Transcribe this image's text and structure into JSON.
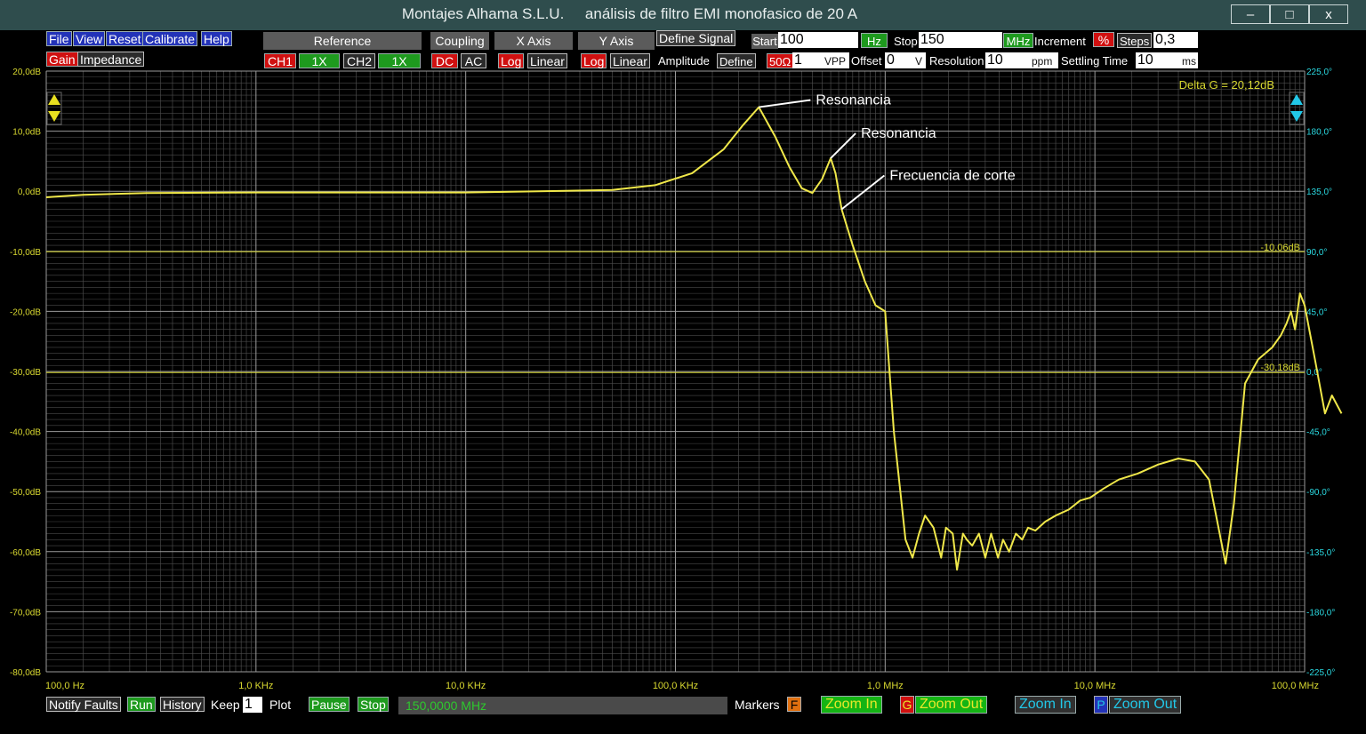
{
  "window": {
    "title": "Montajes Alhama S.L.U.     análisis de filtro EMI monofasico de 20 A",
    "minimize": "–",
    "maximize": "□",
    "close": "x"
  },
  "menu": {
    "file": "File",
    "view": "View",
    "reset": "Reset",
    "calibrate": "Calibrate",
    "help": "Help",
    "gain": "Gain",
    "impedance": "Impedance"
  },
  "toolbar": {
    "reference": "Reference",
    "coupling": "Coupling",
    "x_axis": "X Axis",
    "y_axis": "Y Axis",
    "define_signal": "Define Signal",
    "ch1": "CH1",
    "ch1_x": "1X",
    "ch2": "CH2",
    "ch2_x": "1X",
    "dc": "DC",
    "ac": "AC",
    "x_log": "Log",
    "x_linear": "Linear",
    "y_log": "Log",
    "y_linear": "Linear",
    "amplitude": "Amplitude",
    "define": "Define",
    "ohm": "50Ω",
    "amplitude_value": "1",
    "vpp": "VPP",
    "offset": "Offset",
    "offset_value": "0",
    "offset_unit": "V",
    "start": "Start",
    "start_value": "100",
    "start_unit": "Hz",
    "stop": "Stop",
    "stop_value": "150",
    "stop_unit": "MHz",
    "increment": "Increment",
    "increment_pct": "%",
    "steps": "Steps",
    "steps_value": "0,3",
    "resolution": "Resolution",
    "resolution_value": "10",
    "resolution_unit": "ppm",
    "settling": "Settling Time",
    "settling_value": "10",
    "settling_unit": "ms"
  },
  "plot": {
    "delta_g": "Delta G = 20,12dB",
    "marker_a": "-10,06dB",
    "marker_b": "-30,18dB",
    "annotations": [
      "Resonancia",
      "Resonancia",
      "Frecuencia de corte"
    ]
  },
  "status": {
    "notify_faults": "Notify Faults",
    "run": "Run",
    "history": "History",
    "keep": "Keep",
    "keep_value": "1",
    "plot": "Plot",
    "pause": "Pause",
    "stop": "Stop",
    "frequency": "150,0000 MHz",
    "markers": "Markers",
    "markers_f": "F",
    "zoom_in_g": "Zoom In",
    "g": "G",
    "zoom_out_g": "Zoom Out",
    "zoom_in_p": "Zoom In",
    "p": "P",
    "zoom_out_p": "Zoom Out"
  },
  "colors": {
    "trace": "#f0e84a",
    "gain_axis": "#d8d830",
    "phase_axis": "#2ad8e0",
    "grid": "#5a5a5a"
  },
  "chart_data": {
    "type": "line",
    "xscale": "log",
    "xlim": [
      100,
      100000000
    ],
    "ylim": [
      -80,
      20
    ],
    "y2lim": [
      -225,
      225
    ],
    "grid": true,
    "x_tick_labels": [
      "100,0 Hz",
      "1,0 KHz",
      "10,0 KHz",
      "100,0 KHz",
      "1,0 MHz",
      "10,0 MHz",
      "100,0 MHz"
    ],
    "y_tick_labels": [
      "20,0dB",
      "10,0dB",
      "0,0dB",
      "-10,0dB",
      "-20,0dB",
      "-30,0dB",
      "-40,0dB",
      "-50,0dB",
      "-60,0dB",
      "-70,0dB",
      "-80,0dB"
    ],
    "y2_tick_labels": [
      "225,0°",
      "180,0°",
      "135,0°",
      "90,0°",
      "45,0°",
      "0,0°",
      "-45,0°",
      "-90,0°",
      "-135,0°",
      "-180,0°",
      "-225,0°"
    ],
    "hlines": [
      -10.06,
      -30.18
    ],
    "annotation_points": [
      [
        250000,
        14
      ],
      [
        550000,
        5.5
      ],
      [
        620000,
        -3
      ]
    ],
    "series": [
      {
        "points": [
          [
            100,
            -1
          ],
          [
            150,
            -0.6
          ],
          [
            300,
            -0.3
          ],
          [
            1000,
            -0.2
          ],
          [
            10000,
            -0.2
          ],
          [
            50000,
            0.2
          ],
          [
            80000,
            1
          ],
          [
            120000,
            3
          ],
          [
            170000,
            7
          ],
          [
            210000,
            11
          ],
          [
            250000,
            14
          ],
          [
            300000,
            9
          ],
          [
            350000,
            4
          ],
          [
            400000,
            0.5
          ],
          [
            450000,
            -0.3
          ],
          [
            500000,
            2
          ],
          [
            550000,
            5.5
          ],
          [
            580000,
            3
          ],
          [
            620000,
            -3
          ],
          [
            700000,
            -9
          ],
          [
            800000,
            -15
          ],
          [
            900000,
            -19
          ],
          [
            1000000,
            -20
          ],
          [
            1100000,
            -40
          ],
          [
            1250000,
            -58
          ],
          [
            1350000,
            -61
          ],
          [
            1450000,
            -57
          ],
          [
            1550000,
            -54
          ],
          [
            1700000,
            -56
          ],
          [
            1850000,
            -61
          ],
          [
            1950000,
            -56
          ],
          [
            2100000,
            -57
          ],
          [
            2200000,
            -63
          ],
          [
            2350000,
            -57
          ],
          [
            2450000,
            -58
          ],
          [
            2600000,
            -59
          ],
          [
            2800000,
            -57
          ],
          [
            3000000,
            -61
          ],
          [
            3200000,
            -57
          ],
          [
            3450000,
            -61
          ],
          [
            3650000,
            -58
          ],
          [
            3900000,
            -60
          ],
          [
            4200000,
            -57
          ],
          [
            4500000,
            -58
          ],
          [
            4800000,
            -56
          ],
          [
            5200000,
            -56.5
          ],
          [
            5800000,
            -55
          ],
          [
            6500000,
            -54
          ],
          [
            7500000,
            -53
          ],
          [
            8500000,
            -51.5
          ],
          [
            9500000,
            -51
          ],
          [
            11000000,
            -49.5
          ],
          [
            13000000,
            -48
          ],
          [
            16000000,
            -47
          ],
          [
            20000000,
            -45.5
          ],
          [
            25000000,
            -44.5
          ],
          [
            30000000,
            -45
          ],
          [
            35000000,
            -48
          ],
          [
            42000000,
            -62
          ],
          [
            46000000,
            -52
          ],
          [
            52000000,
            -32
          ],
          [
            60000000,
            -28
          ],
          [
            70000000,
            -26
          ],
          [
            77000000,
            -24
          ],
          [
            82000000,
            -22
          ],
          [
            86000000,
            -20
          ],
          [
            90000000,
            -23
          ],
          [
            95000000,
            -17
          ],
          [
            100000000,
            -19
          ],
          [
            112000000,
            -28
          ],
          [
            125000000,
            -37
          ],
          [
            135000000,
            -34
          ],
          [
            150000000,
            -37
          ]
        ]
      }
    ]
  }
}
